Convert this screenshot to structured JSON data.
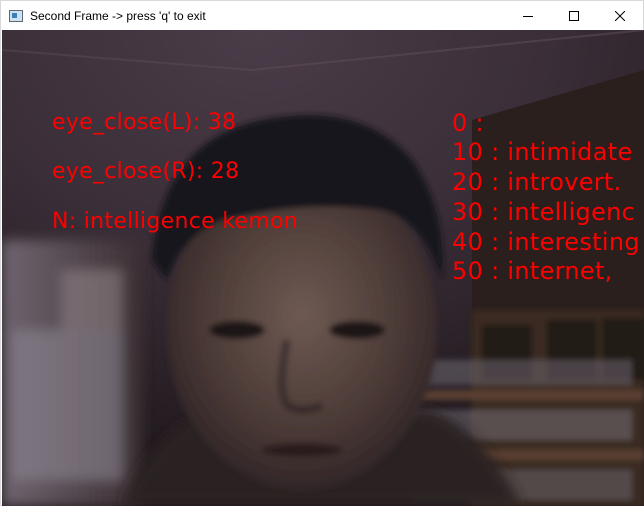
{
  "window": {
    "title": "Second Frame -> press 'q' to exit",
    "controls": {
      "minimize_icon": "minimize-icon",
      "maximize_icon": "maximize-icon",
      "close_icon": "close-icon"
    }
  },
  "overlay": {
    "color": "#ff0000",
    "eye_left": "eye_close(L): 38",
    "eye_right": "eye_close(R): 28",
    "prediction": "N: intelligence kemon",
    "suggestions": [
      "0 :",
      "10 : intimidate",
      "20 : introvert.",
      "30 : intelligenc",
      "40 : interesting",
      "50 : internet,"
    ]
  }
}
